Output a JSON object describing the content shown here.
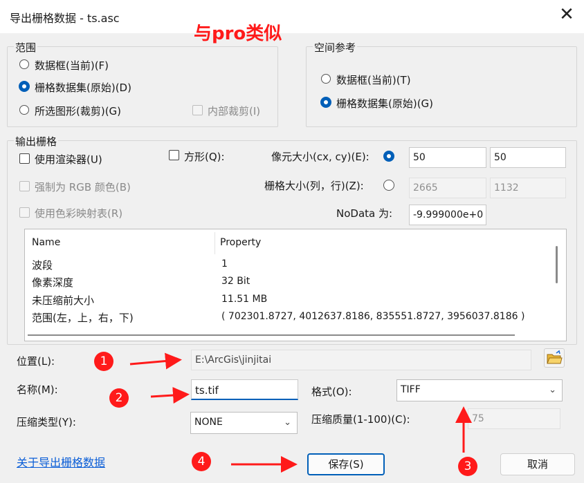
{
  "window": {
    "title": "导出栅格数据 - ts.asc",
    "close_glyph": "✕"
  },
  "annotation_title": "与pro类似",
  "extent": {
    "legend": "范围",
    "options": [
      "数据框(当前)(F)",
      "栅格数据集(原始)(D)",
      "所选图形(裁剪)(G)"
    ],
    "selected": 1,
    "clip_inside": "内部裁剪(I)"
  },
  "spatial_ref": {
    "legend": "空间参考",
    "options": [
      "数据框(当前)(T)",
      "栅格数据集(原始)(G)"
    ],
    "selected": 1
  },
  "output": {
    "legend": "输出栅格",
    "use_renderer": "使用渲染器(U)",
    "square": "方形(Q):",
    "force_rgb": "强制为 RGB 颜色(B)",
    "use_colormap": "使用色彩映射表(R)",
    "cell_size_label": "像元大小(cx, cy)(E):",
    "cell_x": "50",
    "cell_y": "50",
    "raster_size_label": "栅格大小(列，行)(Z):",
    "cols": "2665",
    "rows": "1132",
    "nodata_label": "NoData 为:",
    "nodata_value": "-9.999000e+0"
  },
  "properties": {
    "headers": [
      "Name",
      "Property"
    ],
    "rows": [
      [
        "波段",
        "1"
      ],
      [
        "像素深度",
        "32 Bit"
      ],
      [
        "未压缩前大小",
        "11.51 MB"
      ],
      [
        "范围(左，上，右，下)",
        "( 702301.8727, 4012637.8186, 835551.8727, 3956037.8186 )"
      ]
    ]
  },
  "location": {
    "label": "位置(L):",
    "value": "E:\\ArcGis\\jinjitai"
  },
  "name": {
    "label": "名称(M):",
    "value": "ts.tif"
  },
  "format": {
    "label": "格式(O):",
    "value": "TIFF"
  },
  "compression": {
    "label": "压缩类型(Y):",
    "value": "NONE"
  },
  "quality": {
    "label": "压缩质量(1-100)(C):",
    "value": "75"
  },
  "about_link": "关于导出栅格数据",
  "buttons": {
    "save": "保存(S)",
    "cancel": "取消"
  },
  "markers": [
    "1",
    "2",
    "3",
    "4"
  ],
  "colors": {
    "accent": "#005fb8",
    "annotation": "#ff1a1a"
  }
}
